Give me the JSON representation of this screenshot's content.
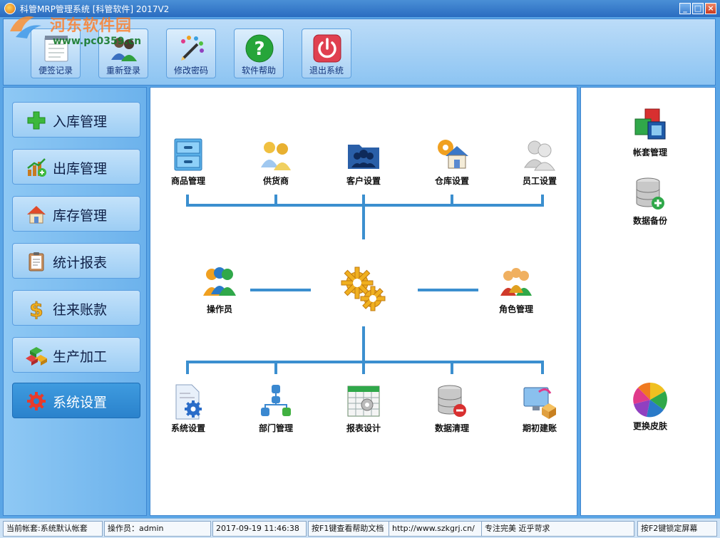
{
  "window": {
    "title": "科管MRP管理系统 [科管软件] 2017V2",
    "controls": {
      "minimize": "_",
      "maximize": "□",
      "close": "×"
    }
  },
  "watermark": {
    "brand": "河东软件园",
    "url": "www.pc0359.cn"
  },
  "toolbar": {
    "buttons": [
      {
        "label": "便签记录",
        "icon": "notepad-icon"
      },
      {
        "label": "重新登录",
        "icon": "users-icon"
      },
      {
        "label": "修改密码",
        "icon": "palette-pencil-icon"
      },
      {
        "label": "软件帮助",
        "icon": "question-icon"
      },
      {
        "label": "退出系统",
        "icon": "power-icon"
      }
    ]
  },
  "sidebar": {
    "items": [
      {
        "label": "入库管理",
        "icon": "plus-icon"
      },
      {
        "label": "出库管理",
        "icon": "chart-icon"
      },
      {
        "label": "库存管理",
        "icon": "house-icon"
      },
      {
        "label": "统计报表",
        "icon": "clipboard-icon"
      },
      {
        "label": "往来账款",
        "icon": "dollar-icon"
      },
      {
        "label": "生产加工",
        "icon": "cubes-icon"
      },
      {
        "label": "系统设置",
        "icon": "gear-icon",
        "active": true
      }
    ]
  },
  "main": {
    "top": [
      {
        "label": "商品管理",
        "icon": "cabinet-icon"
      },
      {
        "label": "供货商",
        "icon": "supplier-icon"
      },
      {
        "label": "客户设置",
        "icon": "customer-folder-icon"
      },
      {
        "label": "仓库设置",
        "icon": "warehouse-icon"
      },
      {
        "label": "员工设置",
        "icon": "staff-icon"
      }
    ],
    "middle_left": {
      "label": "操作员",
      "icon": "operators-icon"
    },
    "center_icon": "gears-icon",
    "middle_right": {
      "label": "角色管理",
      "icon": "roles-icon"
    },
    "bottom": [
      {
        "label": "系统设置",
        "icon": "doc-gear-icon"
      },
      {
        "label": "部门管理",
        "icon": "org-chart-icon"
      },
      {
        "label": "报表设计",
        "icon": "report-grid-icon"
      },
      {
        "label": "数据清理",
        "icon": "db-remove-icon"
      },
      {
        "label": "期初建账",
        "icon": "monitor-box-icon"
      }
    ]
  },
  "right_panel": {
    "items": [
      {
        "label": "帐套管理",
        "icon": "account-set-icon"
      },
      {
        "label": "数据备份",
        "icon": "db-add-icon"
      },
      {
        "label": "更换皮肤",
        "icon": "color-wheel-icon"
      }
    ]
  },
  "statusbar": {
    "account": "当前帐套:系统默认帐套",
    "operator": "操作员：admin",
    "datetime": "2017-09-19 11:46:38",
    "help": "按F1键查看帮助文档",
    "website": "http://www.szkgrj.cn/",
    "slogan": "专注完美 近乎苛求",
    "lock": "按F2键锁定屏幕"
  }
}
